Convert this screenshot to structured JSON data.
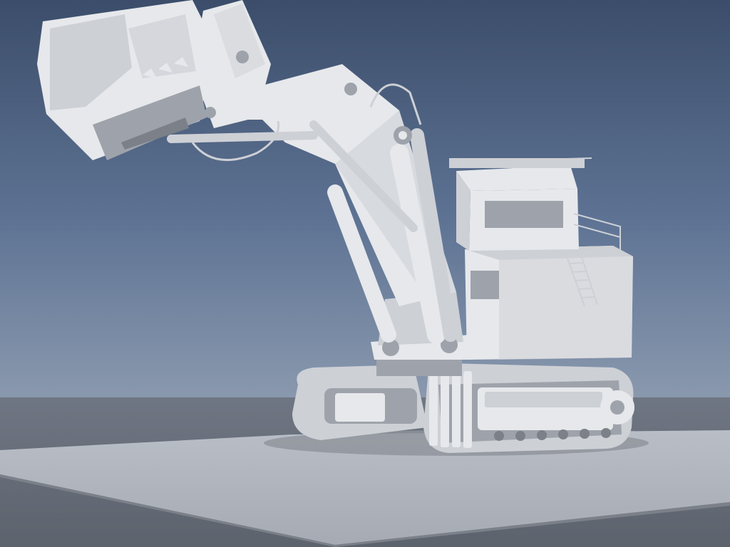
{
  "scene": {
    "subject": "mining-shovel-excavator",
    "render_style": "clay-render",
    "colors": {
      "sky_top": "#3b4d6a",
      "sky_mid": "#5e7394",
      "sky_horizon": "#8a99ae",
      "ground_far": "#6f7683",
      "ground_near": "#5d636d",
      "platform": "#b9bec6",
      "platform_shade": "#a6abb3",
      "machine_light": "#e6e8eb",
      "machine_mid": "#cdd0d5",
      "machine_dark": "#9ea3ab",
      "machine_deep": "#7b8089",
      "shadow": "#8e939b"
    }
  }
}
